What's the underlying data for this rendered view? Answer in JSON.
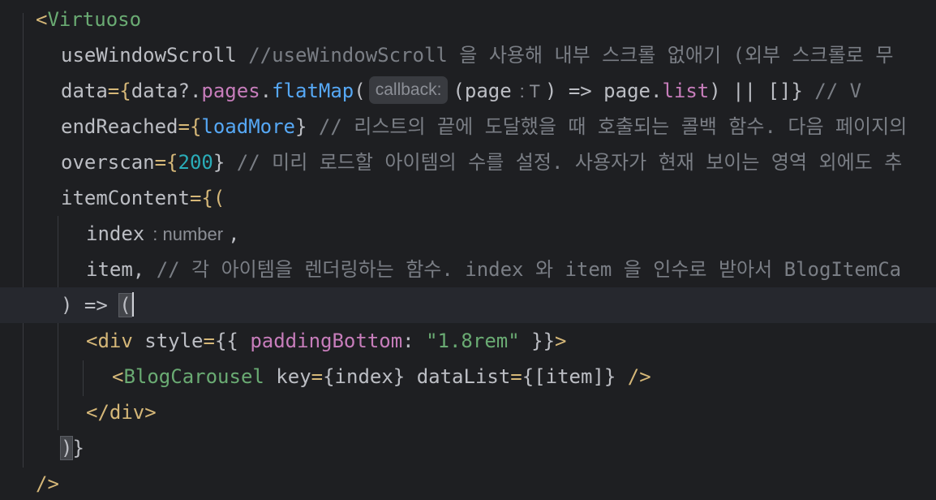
{
  "editor": {
    "lines": [
      {
        "tokens": [
          {
            "t": "<",
            "c": "tag"
          },
          {
            "t": "Virtuoso",
            "c": "comp"
          }
        ]
      },
      {
        "tokens": [
          {
            "t": "useWindowScroll",
            "c": "attr"
          },
          {
            "t": " //useWindowScroll 을 사용해 내부 스크롤 없애기 (외부 스크롤로 무",
            "c": "cmt"
          }
        ]
      },
      {
        "tokens": [
          {
            "t": "data",
            "c": "attr"
          },
          {
            "t": "={",
            "c": "tag"
          },
          {
            "t": "data?.",
            "c": "attr"
          },
          {
            "t": "pages",
            "c": "prop"
          },
          {
            "t": ".",
            "c": "attr"
          },
          {
            "t": "flatMap",
            "c": "fn"
          },
          {
            "t": "(",
            "c": "attr"
          },
          {
            "inlay": "callback:"
          },
          {
            "t": "(page",
            "c": "attr"
          },
          {
            "hint": ": T"
          },
          {
            "t": ") => page.",
            "c": "attr"
          },
          {
            "t": "list",
            "c": "prop"
          },
          {
            "t": ") || []}",
            "c": "attr"
          },
          {
            "t": " // V",
            "c": "cmt"
          }
        ]
      },
      {
        "tokens": [
          {
            "t": "endReached",
            "c": "attr"
          },
          {
            "t": "={",
            "c": "tag"
          },
          {
            "t": "loadMore",
            "c": "fn"
          },
          {
            "t": "}",
            "c": "attr"
          },
          {
            "t": " // 리스트의 끝에 도달했을 때 호출되는 콜백 함수. 다음 페이지의",
            "c": "cmt"
          }
        ]
      },
      {
        "tokens": [
          {
            "t": "overscan",
            "c": "attr"
          },
          {
            "t": "={",
            "c": "tag"
          },
          {
            "t": "200",
            "c": "num"
          },
          {
            "t": "}",
            "c": "attr"
          },
          {
            "t": " // 미리 로드할 아이템의 수를 설정. 사용자가 현재 보이는 영역 외에도 추",
            "c": "cmt"
          }
        ]
      },
      {
        "tokens": [
          {
            "t": "itemContent",
            "c": "attr"
          },
          {
            "t": "={(",
            "c": "tag"
          }
        ]
      },
      {
        "tokens": [
          {
            "t": "index",
            "c": "attr"
          },
          {
            "hint": ": number"
          },
          {
            "t": ",",
            "c": "attr"
          }
        ]
      },
      {
        "tokens": [
          {
            "t": "item",
            "c": "attr"
          },
          {
            "t": ",",
            "c": "attr"
          },
          {
            "t": " // 각 아이템을 렌더링하는 함수. index 와 item 을 인수로 받아서 BlogItemCa",
            "c": "cmt"
          }
        ]
      },
      {
        "tokens": [
          {
            "t": ") => ",
            "c": "attr"
          },
          {
            "t": "(",
            "c": "attr",
            "match": true
          },
          {
            "caret": true
          }
        ]
      },
      {
        "tokens": [
          {
            "t": "<",
            "c": "tag"
          },
          {
            "t": "div",
            "c": "tag"
          },
          {
            "t": " style",
            "c": "attr"
          },
          {
            "t": "=",
            "c": "tag"
          },
          {
            "t": "{{ ",
            "c": "attr"
          },
          {
            "t": "paddingBottom",
            "c": "prop"
          },
          {
            "t": ": ",
            "c": "attr"
          },
          {
            "t": "\"1.8rem\"",
            "c": "str"
          },
          {
            "t": " }}",
            "c": "attr"
          },
          {
            "t": ">",
            "c": "tag"
          }
        ]
      },
      {
        "tokens": [
          {
            "t": "<",
            "c": "tag"
          },
          {
            "t": "BlogCarousel",
            "c": "comp"
          },
          {
            "t": " key",
            "c": "attr"
          },
          {
            "t": "=",
            "c": "tag"
          },
          {
            "t": "{index}",
            "c": "attr"
          },
          {
            "t": " dataList",
            "c": "attr"
          },
          {
            "t": "=",
            "c": "tag"
          },
          {
            "t": "{[item]}",
            "c": "attr"
          },
          {
            "t": " />",
            "c": "tag"
          }
        ]
      },
      {
        "tokens": [
          {
            "t": "</",
            "c": "tag"
          },
          {
            "t": "div",
            "c": "tag"
          },
          {
            "t": ">",
            "c": "tag"
          }
        ]
      },
      {
        "tokens": [
          {
            "t": ")",
            "c": "attr",
            "match": true
          },
          {
            "t": "}",
            "c": "attr"
          }
        ]
      },
      {
        "tokens": [
          {
            "t": "/>",
            "c": "tag"
          }
        ]
      }
    ]
  }
}
